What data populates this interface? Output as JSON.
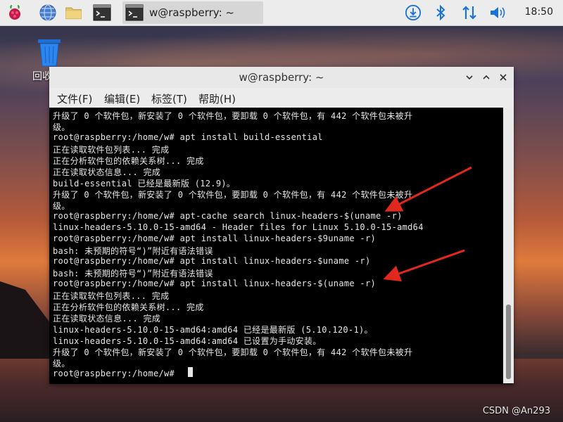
{
  "taskbar": {
    "window_task_title": "w@raspberry: ~",
    "clock": "18:50",
    "icons": [
      "raspberry-menu-icon",
      "browser-globe-icon",
      "file-manager-icon",
      "terminal-icon",
      "download-icon",
      "bluetooth-icon",
      "network-icon",
      "volume-icon"
    ]
  },
  "desktop": {
    "trash_label": "回收"
  },
  "window": {
    "title": "w@raspberry: ~",
    "menu": [
      "文件(F)",
      "编辑(E)",
      "标签(T)",
      "帮助(H)"
    ]
  },
  "terminal": {
    "lines": [
      "升级了 0 个软件包，新安装了 0 个软件包，要卸载 0 个软件包，有 442 个软件包未被升",
      "级。",
      "root@raspberry:/home/w# apt install build-essential",
      "正在读取软件包列表... 完成",
      "正在分析软件包的依赖关系树... 完成",
      "正在读取状态信息... 完成",
      "build-essential 已经是最新版 (12.9)。",
      "升级了 0 个软件包，新安装了 0 个软件包，要卸载 0 个软件包，有 442 个软件包未被升",
      "级。",
      "root@raspberry:/home/w# apt-cache search linux-headers-$(uname -r)",
      "linux-headers-5.10.0-15-amd64 - Header files for Linux 5.10.0-15-amd64",
      "root@raspberry:/home/w# apt install linux-headers-$9uname -r)",
      "bash: 未预期的符号“)”附近有语法错误",
      "root@raspberry:/home/w# apt install linux-headers-$uname -r)",
      "bash: 未预期的符号“)”附近有语法错误",
      "root@raspberry:/home/w# apt install linux-headers-$(uname -r)",
      "正在读取软件包列表... 完成",
      "正在分析软件包的依赖关系树... 完成",
      "正在读取状态信息... 完成",
      "linux-headers-5.10.0-15-amd64:amd64 已经是最新版 (5.10.120-1)。",
      "linux-headers-5.10.0-15-amd64:amd64 已设置为手动安装。",
      "升级了 0 个软件包，新安装了 0 个软件包，要卸载 0 个软件包，有 442 个软件包未被升",
      "级。",
      "root@raspberry:/home/w# "
    ]
  },
  "watermark": "CSDN @An293",
  "colors": {
    "terminal_bg": "#000000",
    "terminal_fg": "#e6e6e6",
    "arrow": "#e0281e",
    "panel": "#ececec",
    "bluetooth": "#1a73d9"
  }
}
